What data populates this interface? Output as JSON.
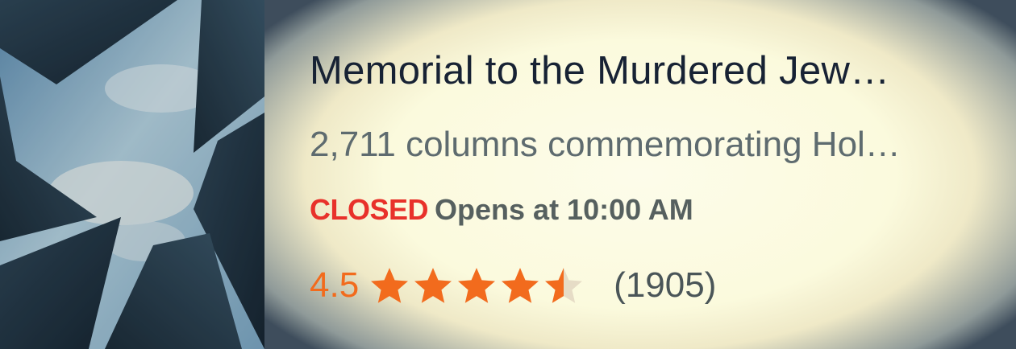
{
  "place": {
    "title": "Memorial to the Murdered Jew…",
    "description": "2,711 columns commemorating Hol…",
    "status": {
      "state": "CLOSED",
      "hours_text": "Opens at 10:00 AM",
      "state_color": "#e8312a"
    },
    "rating": {
      "value": "4.5",
      "stars": 4.5,
      "max_stars": 5,
      "review_count": "(1905)",
      "star_color": "#f26b1d"
    }
  }
}
